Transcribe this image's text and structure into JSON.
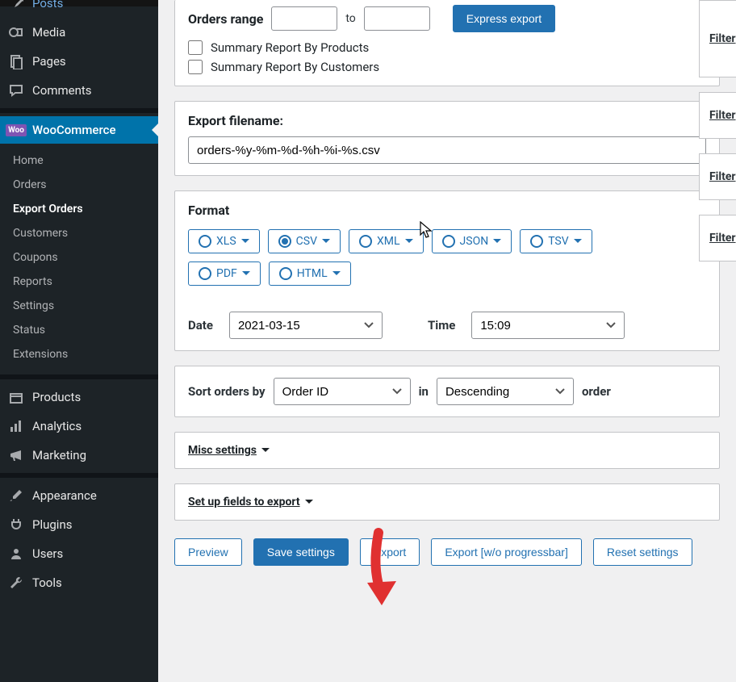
{
  "sidebar": {
    "posts": "Posts",
    "media": "Media",
    "pages": "Pages",
    "comments": "Comments",
    "woocommerce": "WooCommerce",
    "products": "Products",
    "analytics": "Analytics",
    "marketing": "Marketing",
    "appearance": "Appearance",
    "plugins": "Plugins",
    "users": "Users",
    "tools": "Tools",
    "woo_badge": "Woo"
  },
  "submenu": {
    "home": "Home",
    "orders": "Orders",
    "export_orders": "Export Orders",
    "customers": "Customers",
    "coupons": "Coupons",
    "reports": "Reports",
    "settings": "Settings",
    "status": "Status",
    "extensions": "Extensions"
  },
  "range": {
    "label": "Orders range",
    "to": "to",
    "express": "Express export",
    "summary_products": "Summary Report By Products",
    "summary_customers": "Summary Report By Customers"
  },
  "filename": {
    "label": "Export filename:",
    "value": "orders-%y-%m-%d-%h-%i-%s.csv"
  },
  "format": {
    "label": "Format",
    "xls": "XLS",
    "csv": "CSV",
    "xml": "XML",
    "json": "JSON",
    "tsv": "TSV",
    "pdf": "PDF",
    "html": "HTML",
    "date_label": "Date",
    "date_value": "2021-03-15",
    "time_label": "Time",
    "time_value": "15:09"
  },
  "sort": {
    "label": "Sort orders by",
    "field": "Order ID",
    "in": "in",
    "dir": "Descending",
    "order": "order"
  },
  "misc": "Misc settings",
  "setup": "Set up fields to export",
  "buttons": {
    "preview": "Preview",
    "save": "Save settings",
    "export": "Export",
    "export_np": "Export [w/o progressbar]",
    "reset": "Reset settings"
  },
  "side": {
    "filter": "Filter"
  }
}
